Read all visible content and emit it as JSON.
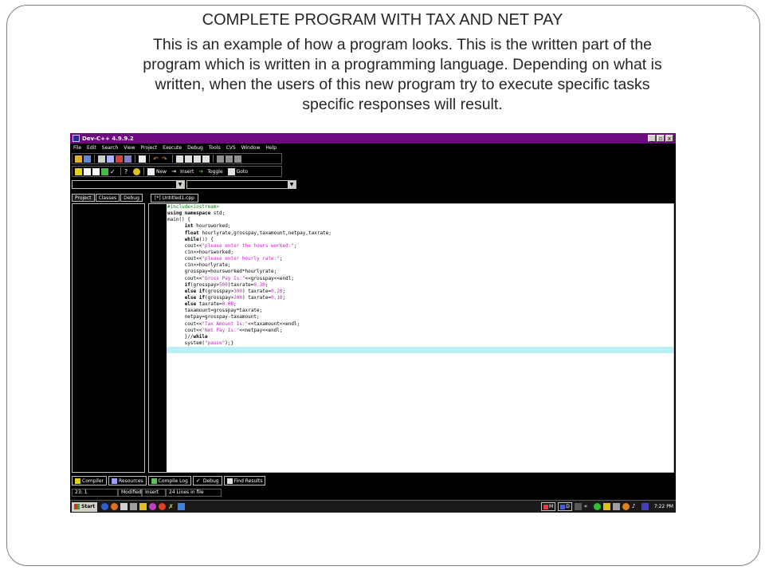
{
  "slide": {
    "title": "COMPLETE PROGRAM WITH TAX AND NET PAY",
    "body_lines": [
      "This is an example of how a program looks. This is the written part of the",
      "program which is written in a programming language.  Depending on what is",
      "written, when the users of this new program try to execute specific tasks",
      "specific responses  will result."
    ]
  },
  "window": {
    "title": "Dev-C++ 4.9.9.2",
    "controls": [
      "_",
      "▫",
      "x"
    ]
  },
  "menu": [
    "File",
    "Edit",
    "Search",
    "View",
    "Project",
    "Execute",
    "Debug",
    "Tools",
    "CVS",
    "Window",
    "Help"
  ],
  "toolbar2": {
    "new": "New",
    "insert": "Insert",
    "toggle": "Toggle",
    "goto": "Goto"
  },
  "left_tabs": [
    "Project",
    "Classes",
    "Debug"
  ],
  "file_tab": "[*] Untitled1.cpp",
  "code_lines": [
    "#include<iostream>",
    "using namespace std;",
    "main() {",
    "      int hoursworked;",
    "      float hourlyrate,grosspay,taxamount,netpay,taxrate;",
    "      while(1) {",
    "      cout<<\"please enter the hours worked:\";",
    "      cin>>hoursworked;",
    "      cout<<\"please enter hourly rate:\";",
    "      cin>>hourlyrate;",
    "      grosspay=hoursworked*hourlyrate;",
    "      cout<<\"Gross Pay Is:\"<<grosspay<<endl;",
    "      if(grosspay>500)taxrate=0.30;",
    "      else if(grosspay>300) taxrate=0.20;",
    "      else if(grosspay>200) taxrate=0.10;",
    "      else taxrate=0.08;",
    "      taxamount=grosspay*taxrate;",
    "      netpay=grosspay-taxamount;",
    "      cout<<\"Tax Amount Is:\"<<taxamount<<endl;",
    "      cout<<\"Net Pay Is:\"<<netpay<<endl;",
    "      }//while",
    "      system(\"pause\");}",
    ""
  ],
  "highlight_line": 23,
  "bottom_tabs": [
    "Compiler",
    "Resources",
    "Compile Log",
    "Debug",
    "Find Results"
  ],
  "status": {
    "position": "23: 1",
    "state": "Modified",
    "mode": "Insert",
    "lines": "24 Lines in file"
  },
  "taskbar": {
    "start": "Start",
    "items": [
      "M",
      "D"
    ],
    "clock": "7:22 PM"
  },
  "colors": {
    "titlebar": "#6e0a7f",
    "editor_highlight": "#b7f0f5",
    "string": "#c81ec8"
  }
}
